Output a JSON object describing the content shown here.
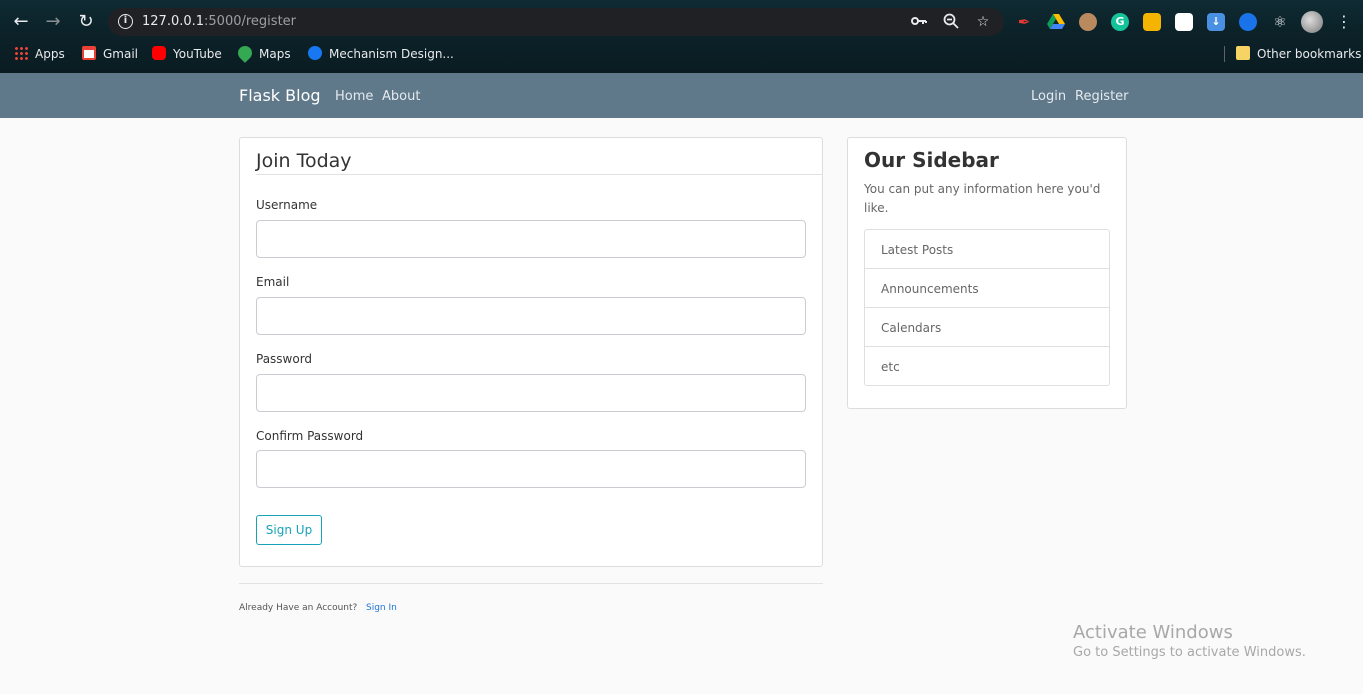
{
  "browser": {
    "url_host": "127.0.0.1",
    "url_path": ":5000/register",
    "info_glyph": "i",
    "extension_icons": [
      "key-icon",
      "zoom-icon",
      "star-icon",
      "pen-icon",
      "drive-icon",
      "owl-icon",
      "grammarly-icon",
      "shield-icon",
      "screen-icon",
      "download-icon",
      "circle-icon",
      "puzzle-icon"
    ],
    "grammarly_glyph": "G",
    "bookmarks": [
      "Apps",
      "Gmail",
      "YouTube",
      "Maps",
      "Mechanism Design..."
    ],
    "other_bookmarks": "Other bookmarks"
  },
  "navbar": {
    "brand": "Flask Blog",
    "links": [
      "Home",
      "About"
    ],
    "right_links": [
      "Login",
      "Register"
    ],
    "bg_color": "#5f788a"
  },
  "form": {
    "legend": "Join Today",
    "fields": [
      {
        "label": "Username",
        "value": ""
      },
      {
        "label": "Email",
        "value": ""
      },
      {
        "label": "Password",
        "value": ""
      },
      {
        "label": "Confirm Password",
        "value": ""
      }
    ],
    "submit": "Sign Up"
  },
  "footer": {
    "text": "Already Have an Account?",
    "link": "Sign In"
  },
  "sidebar": {
    "title": "Our Sidebar",
    "description": "You can put any information here you'd like.",
    "items": [
      "Latest Posts",
      "Announcements",
      "Calendars",
      "etc"
    ]
  },
  "watermark": {
    "line1": "Activate Windows",
    "line2": "Go to Settings to activate Windows."
  },
  "colors": {
    "accent": "#17a2b8",
    "link": "#1e73d6"
  }
}
